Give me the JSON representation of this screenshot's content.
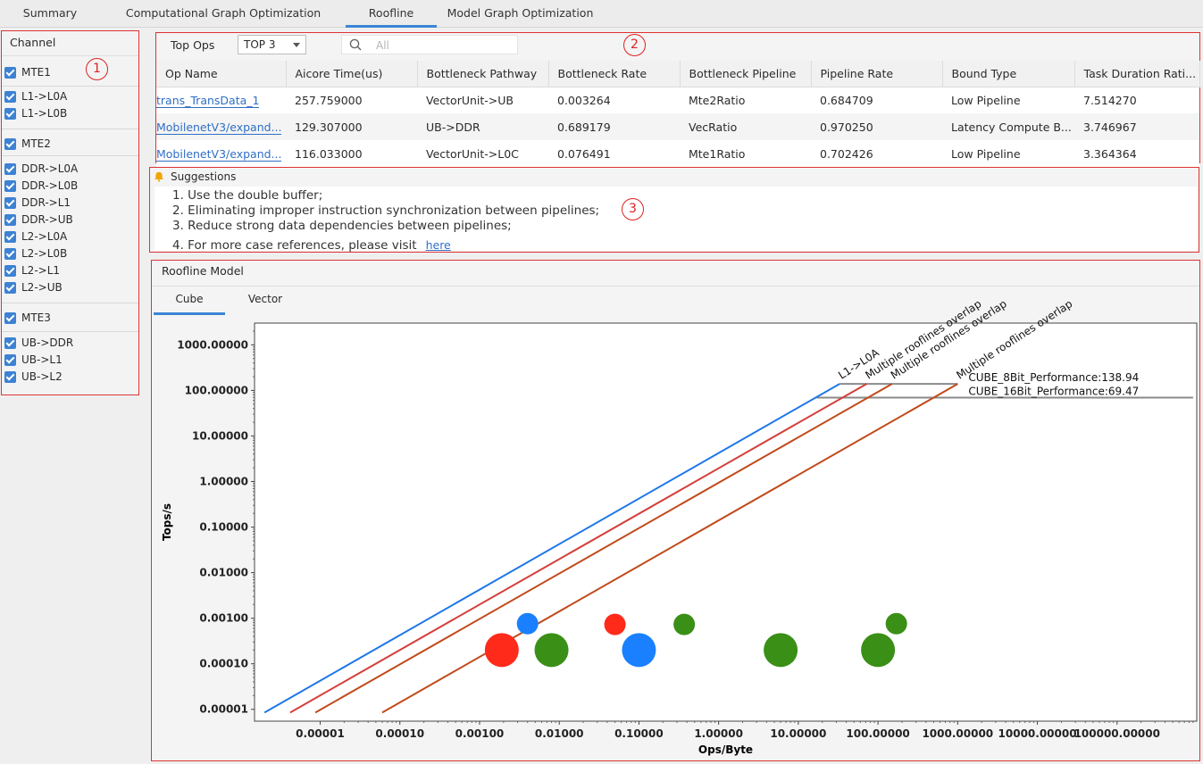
{
  "top_tabs": [
    "Summary",
    "Computational Graph Optimization",
    "Roofline",
    "Model Graph Optimization"
  ],
  "active_tab": "Roofline",
  "annotations": [
    "1",
    "2",
    "3",
    "4"
  ],
  "channel": {
    "title": "Channel",
    "groups": [
      {
        "label": "MTE1",
        "checked": true,
        "items": [
          "L1->L0A",
          "L1->L0B"
        ]
      },
      {
        "label": "MTE2",
        "checked": true,
        "items": [
          "DDR->L0A",
          "DDR->L0B",
          "DDR->L1",
          "DDR->UB",
          "L2->L0A",
          "L2->L0B",
          "L2->L1",
          "L2->UB"
        ]
      },
      {
        "label": "MTE3",
        "checked": true,
        "items": [
          "UB->DDR",
          "UB->L1",
          "UB->L2"
        ]
      }
    ]
  },
  "top_ops": {
    "label": "Top Ops",
    "selected": "TOP 3",
    "search_placeholder": "All",
    "columns": [
      "Op Name",
      "Aicore Time(us)",
      "Bottleneck Pathway",
      "Bottleneck Rate",
      "Bottleneck Pipeline",
      "Pipeline Rate",
      "Bound Type",
      "Task Duration Rati..."
    ],
    "rows": [
      [
        "trans_TransData_1",
        "257.759000",
        "VectorUnit->UB",
        "0.003264",
        "Mte2Ratio",
        "0.684709",
        "Low Pipeline",
        "7.514270"
      ],
      [
        "MobilenetV3/expand...",
        "129.307000",
        "UB->DDR",
        "0.689179",
        "VecRatio",
        "0.970250",
        "Latency Compute B...",
        "3.746967"
      ],
      [
        "MobilenetV3/expand...",
        "116.033000",
        "VectorUnit->L0C",
        "0.076491",
        "Mte1Ratio",
        "0.702426",
        "Low Pipeline",
        "3.364364"
      ]
    ]
  },
  "suggestions": {
    "title": "Suggestions",
    "lines": [
      "1. Use the double buffer;",
      "2. Eliminating improper instruction synchronization between pipelines;",
      "3. Reduce strong data dependencies between pipelines;",
      "4. For more case references, please visit"
    ],
    "link": "here"
  },
  "roofline": {
    "title": "Roofline Model",
    "tabs": [
      "Cube",
      "Vector"
    ],
    "active_tab": "Cube"
  },
  "chart_data": {
    "type": "scatter",
    "xscale": "log",
    "yscale": "log",
    "xlabel": "Ops/Byte",
    "ylabel": "Tops/s",
    "xticks": [
      "0.00001",
      "0.00010",
      "0.00100",
      "0.01000",
      "0.10000",
      "1.00000",
      "10.00000",
      "100.00000",
      "1000.00000",
      "10000.00000",
      "100000.00000"
    ],
    "yticks": [
      "0.00001",
      "0.00010",
      "0.00100",
      "0.01000",
      "0.10000",
      "1.00000",
      "10.00000",
      "100.00000",
      "1000.00000"
    ],
    "xlim": [
      1.5e-06,
      1000000
    ],
    "ylim": [
      5.5e-06,
      3000
    ],
    "rooflines": [
      {
        "label": "L1->L0A",
        "color": "#1f77e8",
        "x_start": 2e-06,
        "y_start": 8.5e-06,
        "x_knee": 33,
        "y_knee": 138.94
      },
      {
        "label": "Multiple rooflines overlap",
        "color": "#d43f3a",
        "x_start": 4.2e-06,
        "y_start": 8.5e-06,
        "x_knee": 72,
        "y_knee": 138.94
      },
      {
        "label": "Multiple rooflines overlap",
        "color": "#c14a1b",
        "x_start": 8.7e-06,
        "y_start": 8.5e-06,
        "x_knee": 150,
        "y_knee": 138.94
      },
      {
        "label": "Multiple rooflines overlap",
        "color": "#c14a1b",
        "x_start": 6e-05,
        "y_start": 8.5e-06,
        "x_knee": 1000,
        "y_knee": 138.94
      }
    ],
    "ceilings": [
      {
        "label": "CUBE_8Bit_Performance:138.94",
        "value": 138.94,
        "x_from": 33,
        "x_to": 1000
      },
      {
        "label": "CUBE_16Bit_Performance:69.47",
        "value": 69.47,
        "x_from": 17,
        "x_to": 900000
      }
    ],
    "points": [
      {
        "x": 0.0019,
        "y": 0.0002,
        "color": "#ff2a1a",
        "size": "large"
      },
      {
        "x": 0.004,
        "y": 0.00076,
        "color": "#1a80ff",
        "size": "small"
      },
      {
        "x": 0.008,
        "y": 0.0002,
        "color": "#3a8f16",
        "size": "large"
      },
      {
        "x": 0.05,
        "y": 0.00073,
        "color": "#ff2a1a",
        "size": "small"
      },
      {
        "x": 0.1,
        "y": 0.0002,
        "color": "#1a80ff",
        "size": "large"
      },
      {
        "x": 0.37,
        "y": 0.00073,
        "color": "#3a8f16",
        "size": "small"
      },
      {
        "x": 6,
        "y": 0.0002,
        "color": "#3a8f16",
        "size": "large"
      },
      {
        "x": 100,
        "y": 0.0002,
        "color": "#3a8f16",
        "size": "large"
      },
      {
        "x": 170,
        "y": 0.00076,
        "color": "#3a8f16",
        "size": "small"
      }
    ]
  }
}
